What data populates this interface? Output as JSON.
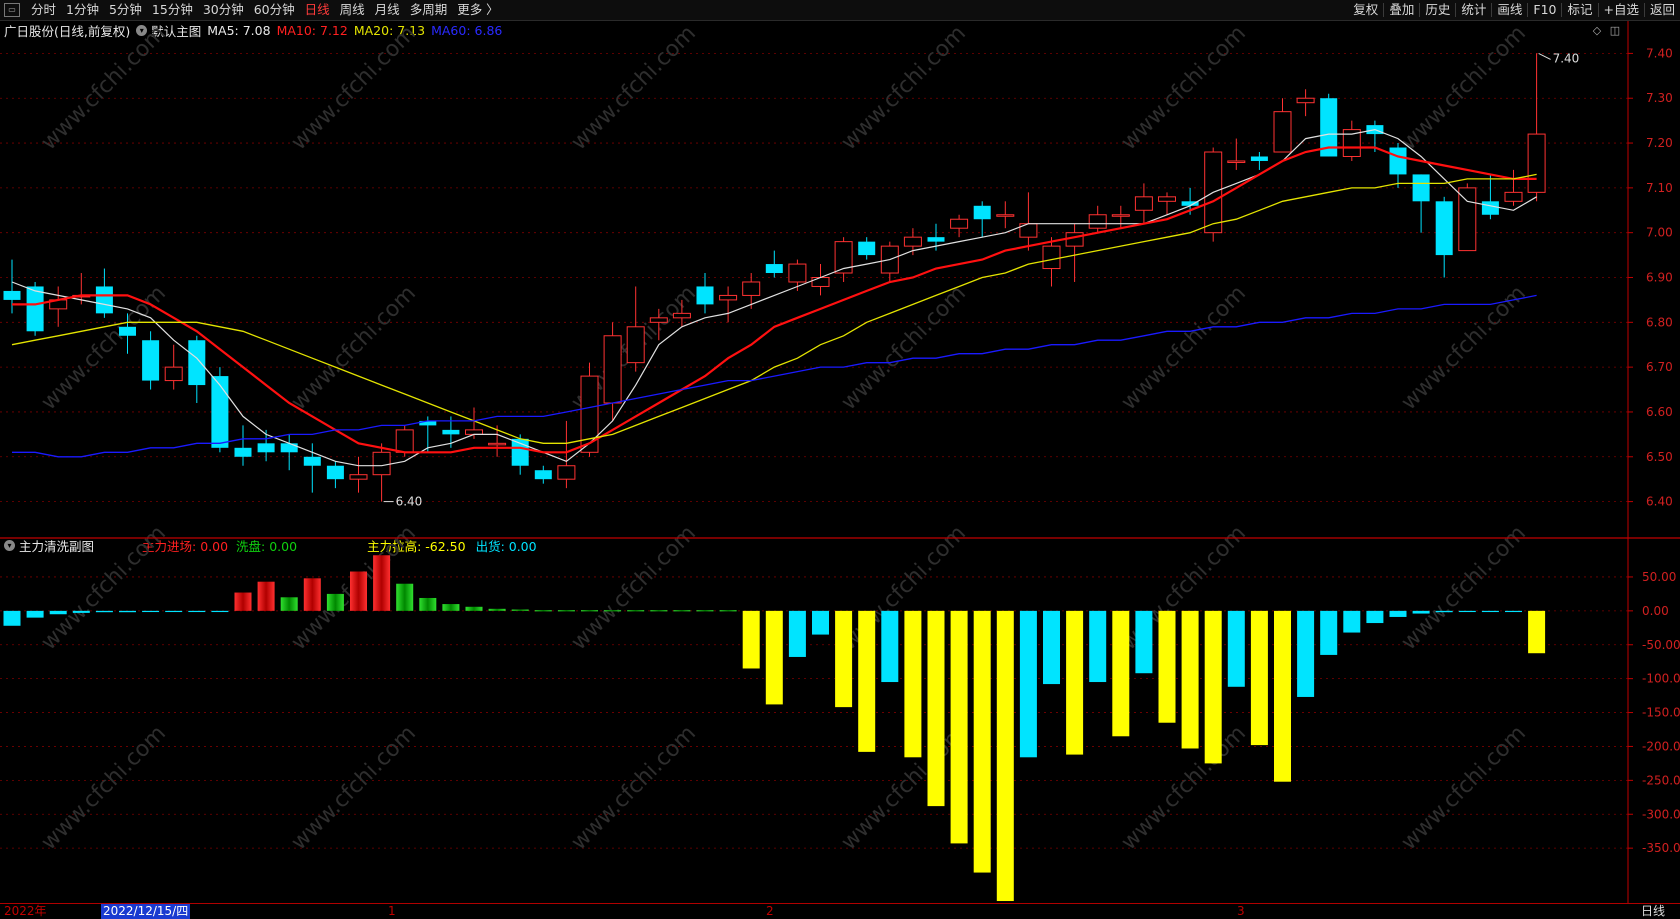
{
  "toolbar": {
    "left_items": [
      "分时",
      "1分钟",
      "5分钟",
      "15分钟",
      "30分钟",
      "60分钟",
      "日线",
      "周线",
      "月线",
      "多周期",
      "更多 〉"
    ],
    "active_item": "日线",
    "right_items": [
      "复权",
      "叠加",
      "历史",
      "统计",
      "画线",
      "F10",
      "标记",
      "+自选",
      "返回"
    ]
  },
  "main_legend": {
    "stock": "广日股份(日线,前复权)",
    "template": "默认主图",
    "ma5": "MA5: 7.08",
    "ma10": "MA10: 7.12",
    "ma20": "MA20: 7.13",
    "ma60": "MA60: 6.86"
  },
  "colors": {
    "up": "#ff3232",
    "down": "#00e4ff",
    "ma5": "#e0e0e0",
    "ma10": "#ff1010",
    "ma20": "#e3e300",
    "ma60": "#1a1aff",
    "grid": "#7a0000",
    "axis": "#c00000",
    "sub_red": "#e00000",
    "sub_green": "#10c010",
    "sub_yellow": "#ffff00",
    "sub_cyan": "#00e4ff"
  },
  "sub_legend": {
    "title": "主力清洗副图",
    "entry": "主力进场: 0.00",
    "wash": "洗盘: 0.00",
    "lift": "主力拉高: -62.50",
    "out": "出货: 0.00"
  },
  "chart_data": [
    {
      "type": "candlestick",
      "ylim": [
        6.35,
        7.45
      ],
      "y_ticks": [
        "7.40",
        "7.30",
        "7.20",
        "7.10",
        "7.00",
        "6.90",
        "6.80",
        "6.70",
        "6.60",
        "6.50",
        "6.40"
      ],
      "annotations": {
        "high": "7.40",
        "low": "6.40"
      },
      "candles": [
        [
          6.87,
          6.85,
          6.94,
          6.82
        ],
        [
          6.88,
          6.78,
          6.89,
          6.77
        ],
        [
          6.83,
          6.85,
          6.88,
          6.79
        ],
        [
          6.86,
          6.86,
          6.91,
          6.84
        ],
        [
          6.88,
          6.82,
          6.92,
          6.81
        ],
        [
          6.79,
          6.77,
          6.82,
          6.73
        ],
        [
          6.76,
          6.67,
          6.78,
          6.65
        ],
        [
          6.67,
          6.7,
          6.75,
          6.65
        ],
        [
          6.76,
          6.66,
          6.77,
          6.62
        ],
        [
          6.68,
          6.52,
          6.7,
          6.51
        ],
        [
          6.52,
          6.5,
          6.57,
          6.48
        ],
        [
          6.53,
          6.51,
          6.56,
          6.49
        ],
        [
          6.53,
          6.51,
          6.55,
          6.47
        ],
        [
          6.5,
          6.48,
          6.53,
          6.42
        ],
        [
          6.48,
          6.45,
          6.49,
          6.43
        ],
        [
          6.45,
          6.46,
          6.5,
          6.42
        ],
        [
          6.46,
          6.51,
          6.53,
          6.4
        ],
        [
          6.51,
          6.56,
          6.57,
          6.5
        ],
        [
          6.58,
          6.57,
          6.59,
          6.51
        ],
        [
          6.56,
          6.55,
          6.59,
          6.52
        ],
        [
          6.55,
          6.56,
          6.61,
          6.54
        ],
        [
          6.53,
          6.53,
          6.57,
          6.5
        ],
        [
          6.54,
          6.48,
          6.55,
          6.46
        ],
        [
          6.47,
          6.45,
          6.48,
          6.44
        ],
        [
          6.45,
          6.48,
          6.58,
          6.43
        ],
        [
          6.51,
          6.68,
          6.71,
          6.5
        ],
        [
          6.62,
          6.77,
          6.8,
          6.58
        ],
        [
          6.71,
          6.79,
          6.88,
          6.69
        ],
        [
          6.8,
          6.81,
          6.83,
          6.76
        ],
        [
          6.81,
          6.82,
          6.85,
          6.79
        ],
        [
          6.88,
          6.84,
          6.91,
          6.82
        ],
        [
          6.85,
          6.86,
          6.88,
          6.8
        ],
        [
          6.86,
          6.89,
          6.91,
          6.83
        ],
        [
          6.93,
          6.91,
          6.96,
          6.9
        ],
        [
          6.89,
          6.93,
          6.94,
          6.87
        ],
        [
          6.88,
          6.9,
          6.93,
          6.86
        ],
        [
          6.91,
          6.98,
          6.99,
          6.89
        ],
        [
          6.98,
          6.95,
          6.99,
          6.94
        ],
        [
          6.91,
          6.97,
          6.98,
          6.89
        ],
        [
          6.97,
          6.99,
          7.01,
          6.95
        ],
        [
          6.99,
          6.98,
          7.02,
          6.96
        ],
        [
          7.01,
          7.03,
          7.04,
          6.99
        ],
        [
          7.06,
          7.03,
          7.07,
          6.99
        ],
        [
          7.04,
          7.04,
          7.07,
          7.01
        ],
        [
          6.99,
          7.02,
          7.09,
          6.96
        ],
        [
          6.92,
          6.97,
          6.99,
          6.88
        ],
        [
          6.97,
          7.0,
          7.02,
          6.89
        ],
        [
          7.01,
          7.04,
          7.06,
          7.0
        ],
        [
          7.04,
          7.04,
          7.06,
          7.01
        ],
        [
          7.05,
          7.08,
          7.11,
          7.02
        ],
        [
          7.07,
          7.08,
          7.09,
          7.04
        ],
        [
          7.07,
          7.06,
          7.1,
          7.04
        ],
        [
          7.0,
          7.18,
          7.19,
          6.98
        ],
        [
          7.16,
          7.16,
          7.21,
          7.14
        ],
        [
          7.17,
          7.16,
          7.18,
          7.14
        ],
        [
          7.18,
          7.27,
          7.3,
          7.18
        ],
        [
          7.29,
          7.3,
          7.32,
          7.26
        ],
        [
          7.3,
          7.17,
          7.31,
          7.17
        ],
        [
          7.17,
          7.23,
          7.25,
          7.16
        ],
        [
          7.24,
          7.22,
          7.25,
          7.18
        ],
        [
          7.19,
          7.13,
          7.2,
          7.1
        ],
        [
          7.13,
          7.07,
          7.13,
          7.0
        ],
        [
          7.07,
          6.95,
          7.08,
          6.9
        ],
        [
          6.96,
          7.1,
          7.11,
          6.96
        ],
        [
          7.07,
          7.04,
          7.13,
          7.03
        ],
        [
          7.07,
          7.09,
          7.14,
          7.06
        ],
        [
          7.09,
          7.22,
          7.4,
          7.07
        ]
      ],
      "ma5": [
        6.89,
        6.87,
        6.86,
        6.85,
        6.84,
        6.83,
        6.81,
        6.76,
        6.72,
        6.66,
        6.59,
        6.55,
        6.53,
        6.51,
        6.49,
        6.48,
        6.48,
        6.49,
        6.52,
        6.53,
        6.55,
        6.55,
        6.53,
        6.51,
        6.49,
        6.53,
        6.58,
        6.66,
        6.75,
        6.79,
        6.81,
        6.82,
        6.84,
        6.86,
        6.88,
        6.9,
        6.92,
        6.93,
        6.94,
        6.96,
        6.97,
        6.98,
        6.99,
        7.0,
        7.02,
        7.02,
        7.02,
        7.02,
        7.02,
        7.02,
        7.04,
        7.06,
        7.09,
        7.11,
        7.13,
        7.16,
        7.21,
        7.22,
        7.22,
        7.23,
        7.21,
        7.17,
        7.12,
        7.07,
        7.06,
        7.05,
        7.08
      ],
      "ma10": [
        6.84,
        6.84,
        6.85,
        6.86,
        6.86,
        6.86,
        6.84,
        6.81,
        6.78,
        6.74,
        6.7,
        6.66,
        6.62,
        6.59,
        6.56,
        6.53,
        6.52,
        6.51,
        6.51,
        6.51,
        6.52,
        6.52,
        6.52,
        6.51,
        6.51,
        6.53,
        6.56,
        6.59,
        6.62,
        6.65,
        6.68,
        6.72,
        6.75,
        6.79,
        6.81,
        6.83,
        6.85,
        6.87,
        6.89,
        6.9,
        6.92,
        6.93,
        6.94,
        6.96,
        6.97,
        6.98,
        6.99,
        7.0,
        7.01,
        7.02,
        7.03,
        7.05,
        7.07,
        7.1,
        7.13,
        7.16,
        7.18,
        7.19,
        7.19,
        7.19,
        7.17,
        7.16,
        7.15,
        7.14,
        7.13,
        7.12,
        7.12
      ],
      "ma20": [
        6.75,
        6.76,
        6.77,
        6.78,
        6.79,
        6.8,
        6.8,
        6.8,
        6.8,
        6.79,
        6.78,
        6.76,
        6.74,
        6.72,
        6.7,
        6.68,
        6.66,
        6.64,
        6.62,
        6.6,
        6.58,
        6.56,
        6.54,
        6.53,
        6.53,
        6.54,
        6.55,
        6.57,
        6.59,
        6.61,
        6.63,
        6.65,
        6.67,
        6.7,
        6.72,
        6.75,
        6.77,
        6.8,
        6.82,
        6.84,
        6.86,
        6.88,
        6.9,
        6.91,
        6.93,
        6.94,
        6.95,
        6.96,
        6.97,
        6.98,
        6.99,
        7.0,
        7.02,
        7.03,
        7.05,
        7.07,
        7.08,
        7.09,
        7.1,
        7.1,
        7.11,
        7.11,
        7.11,
        7.12,
        7.12,
        7.12,
        7.13
      ],
      "ma60": [
        6.51,
        6.51,
        6.5,
        6.5,
        6.51,
        6.51,
        6.52,
        6.52,
        6.53,
        6.53,
        6.54,
        6.54,
        6.55,
        6.55,
        6.56,
        6.56,
        6.57,
        6.57,
        6.58,
        6.58,
        6.58,
        6.59,
        6.59,
        6.59,
        6.6,
        6.61,
        6.62,
        6.63,
        6.64,
        6.65,
        6.66,
        6.67,
        6.67,
        6.68,
        6.69,
        6.7,
        6.7,
        6.71,
        6.71,
        6.72,
        6.72,
        6.73,
        6.73,
        6.74,
        6.74,
        6.75,
        6.75,
        6.76,
        6.76,
        6.77,
        6.78,
        6.78,
        6.79,
        6.79,
        6.8,
        6.8,
        6.81,
        6.81,
        6.82,
        6.82,
        6.83,
        6.83,
        6.84,
        6.84,
        6.84,
        6.85,
        6.86
      ]
    },
    {
      "type": "bar",
      "ylim": [
        -425,
        75
      ],
      "y_ticks": [
        "50.00",
        "0.00",
        "-50.00",
        "-100.0",
        "-150.0",
        "-200.0",
        "-250.0",
        "-300.0",
        "-350.0"
      ],
      "values": [
        -22,
        -10,
        -5,
        -3,
        -2,
        -2,
        -1,
        -1,
        -1,
        -1,
        27,
        43,
        20,
        48,
        25,
        58,
        82,
        40,
        19,
        10,
        6,
        3,
        2,
        1,
        1,
        1,
        1,
        1,
        1,
        1,
        1,
        1,
        -85,
        -138,
        -68,
        -35,
        -142,
        -208,
        -105,
        -216,
        -288,
        -343,
        -386,
        -428,
        -216,
        -108,
        -212,
        -105,
        -185,
        -92,
        -165,
        -203,
        -225,
        -112,
        -198,
        -252,
        -127,
        -65,
        -32,
        -18,
        -9,
        -4,
        -2,
        -1,
        -1,
        -1,
        -62.5
      ],
      "colors": [
        "c",
        "c",
        "c",
        "c",
        "c",
        "c",
        "c",
        "c",
        "c",
        "c",
        "r",
        "r",
        "g",
        "r",
        "g",
        "r",
        "r",
        "g",
        "g",
        "g",
        "g",
        "g",
        "g",
        "g",
        "g",
        "g",
        "g",
        "g",
        "g",
        "g",
        "g",
        "g",
        "y",
        "y",
        "c",
        "c",
        "y",
        "y",
        "c",
        "y",
        "y",
        "y",
        "y",
        "y",
        "c",
        "c",
        "y",
        "c",
        "y",
        "c",
        "y",
        "y",
        "y",
        "c",
        "y",
        "y",
        "c",
        "c",
        "c",
        "c",
        "c",
        "c",
        "c",
        "c",
        "c",
        "c",
        "y"
      ]
    }
  ],
  "status": {
    "year": "2022年",
    "cursor_date": "2022/12/15/四",
    "months": [
      "1",
      "2",
      "3"
    ],
    "period": "日线"
  },
  "watermark": "www.cfchi.com"
}
